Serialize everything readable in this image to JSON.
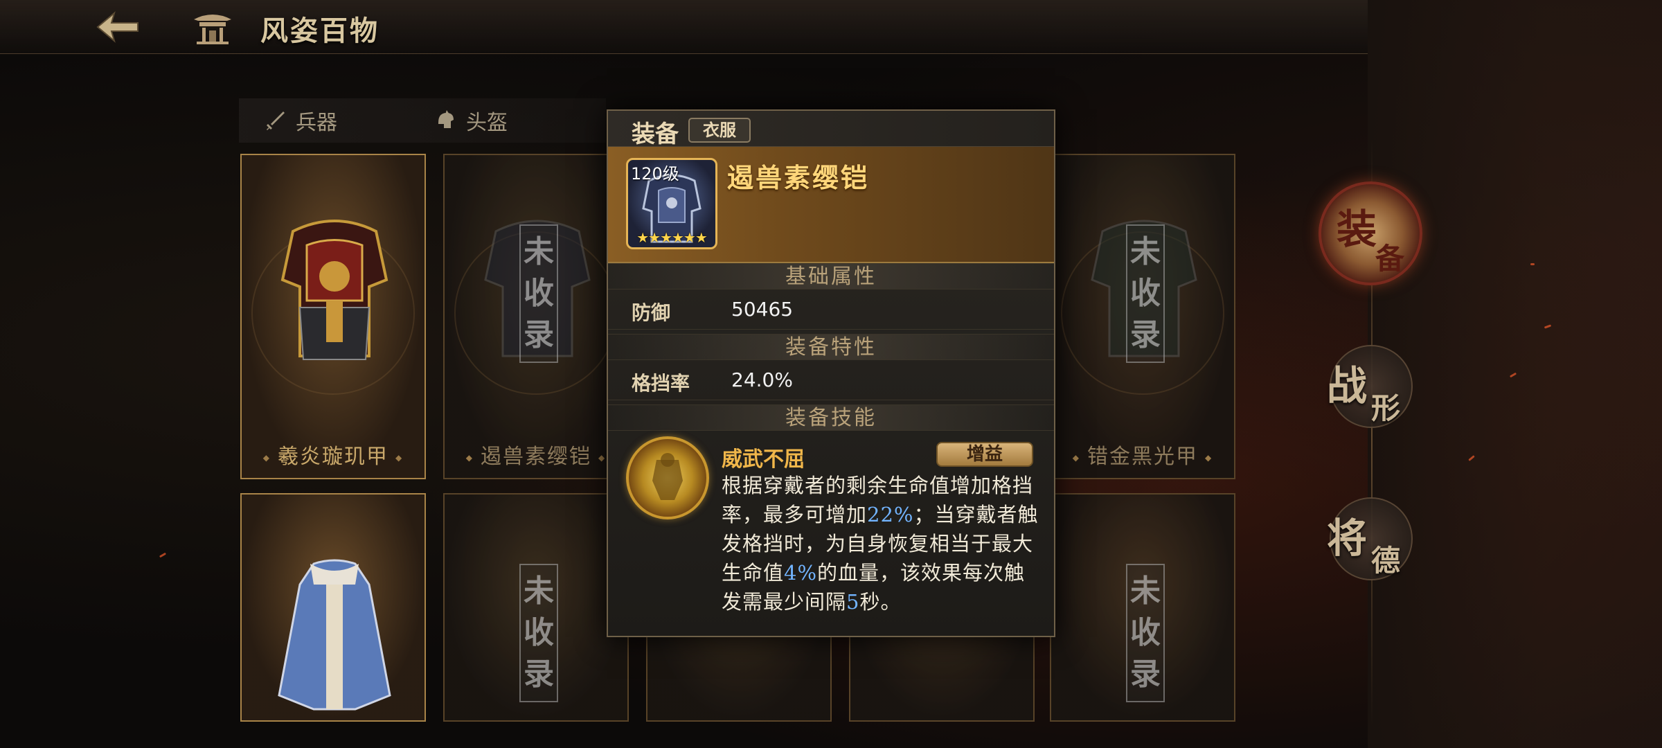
{
  "header": {
    "title": "风姿百物"
  },
  "tabs": [
    {
      "label": "兵器",
      "icon": "sword-icon"
    },
    {
      "label": "头盔",
      "icon": "helmet-icon"
    }
  ],
  "cards": {
    "top": [
      {
        "name": "羲炎璇玑甲",
        "status": ""
      },
      {
        "name": "遏兽素缨铠",
        "status": "未收录"
      },
      {
        "name": "",
        "status": ""
      },
      {
        "name": "",
        "status": ""
      },
      {
        "name": "错金黑光甲",
        "status": "未收录"
      }
    ],
    "bottom": [
      {
        "name": "",
        "status": ""
      },
      {
        "name": "",
        "status": "未收录"
      },
      {
        "name": "",
        "status": ""
      },
      {
        "name": "",
        "status": ""
      },
      {
        "name": "",
        "status": "未收录"
      }
    ]
  },
  "stamp_chars": [
    "未",
    "收",
    "录"
  ],
  "side_nav": [
    {
      "c1": "装",
      "c2": "备",
      "active": true
    },
    {
      "c1": "战",
      "c2": "形",
      "active": false
    },
    {
      "c1": "将",
      "c2": "德",
      "active": false
    }
  ],
  "popup": {
    "kind": "装备",
    "type": "衣服",
    "item_level": "120级",
    "item_stars": "★★★★★★",
    "item_name": "遏兽素缨铠",
    "sections": {
      "base": "基础属性",
      "trait": "装备特性",
      "skill": "装备技能"
    },
    "stats": {
      "defense_label": "防御",
      "defense_value": "50465",
      "block_label": "格挡率",
      "block_value": "24.0%"
    },
    "skill": {
      "name": "威武不屈",
      "tag": "增益",
      "desc_1": "根据穿戴者的剩余生命值增加格挡率，最多可增加",
      "hl_1": "22%",
      "desc_2": "；当穿戴者触发格挡时，为自身恢复相当于最大生命值",
      "hl_2": "4%",
      "desc_3": "的血量，该效果每次触发需最少间隔",
      "hl_3": "5",
      "desc_4": "秒。"
    }
  },
  "colors": {
    "accent_gold": "#ffd67a",
    "highlight_blue": "#72b4ff",
    "skill_orange": "#f0b64a"
  }
}
